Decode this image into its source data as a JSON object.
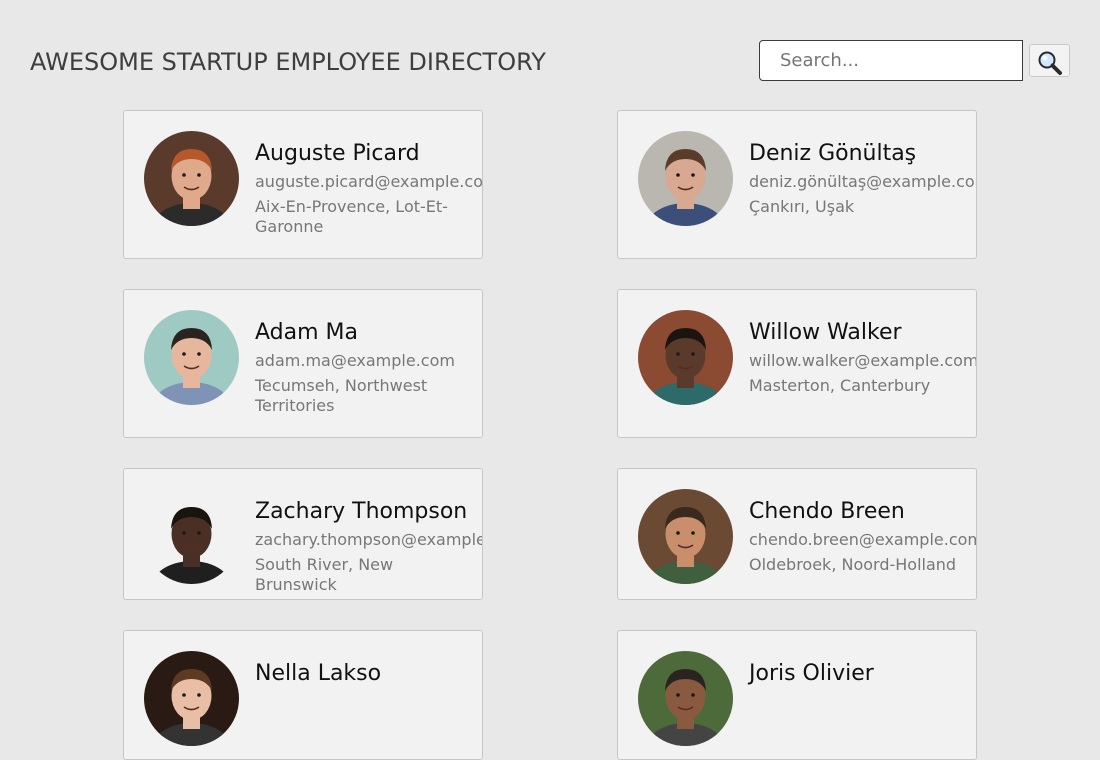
{
  "header": {
    "title": "AWESOME STARTUP EMPLOYEE DIRECTORY",
    "search_placeholder": "Search...",
    "search_icon": "magnifier-icon"
  },
  "employees": [
    {
      "name": "Auguste Picard",
      "email": "auguste.picard@example.com",
      "location": "Aix-En-Provence, Lot-Et-Garonne",
      "skin": "#e0a98c",
      "hair": "#b5582c",
      "bg": "#5a3a2a",
      "shirt": "#2b2b2b"
    },
    {
      "name": "Deniz Gönültaş",
      "email": "deniz.gönültaş@example.com",
      "location": "Çankırı, Uşak",
      "skin": "#d8a890",
      "hair": "#5a3c2a",
      "bg": "#b9b7b0",
      "shirt": "#3c4f7a"
    },
    {
      "name": "Adam Ma",
      "email": "adam.ma@example.com",
      "location": "Tecumseh, Northwest Territories",
      "skin": "#e6b79c",
      "hair": "#2a2420",
      "bg": "#9fc9c3",
      "shirt": "#7e93b5"
    },
    {
      "name": "Willow Walker",
      "email": "willow.walker@example.com",
      "location": "Masterton, Canterbury",
      "skin": "#5a3a2a",
      "hair": "#1c1410",
      "bg": "#8a4b32",
      "shirt": "#2d6a6a"
    },
    {
      "name": "Zachary Thompson",
      "email": "zachary.thompson@example.com",
      "location": "South River, New Brunswick",
      "skin": "#4a3024",
      "hair": "#1a1410",
      "bg": "#f2f2f2",
      "shirt": "#1f1f1f"
    },
    {
      "name": "Chendo Breen",
      "email": "chendo.breen@example.com",
      "location": "Oldebroek, Noord-Holland",
      "skin": "#c98e6c",
      "hair": "#3a2a1e",
      "bg": "#6b4a34",
      "shirt": "#3f5f3f"
    },
    {
      "name": "Nella Lakso",
      "email": "",
      "location": "",
      "skin": "#e8bfa6",
      "hair": "#5e3a22",
      "bg": "#2a1a14",
      "shirt": "#333333"
    },
    {
      "name": "Joris Olivier",
      "email": "",
      "location": "",
      "skin": "#8a5a40",
      "hair": "#2a2420",
      "bg": "#4d6a3a",
      "shirt": "#444444"
    }
  ]
}
